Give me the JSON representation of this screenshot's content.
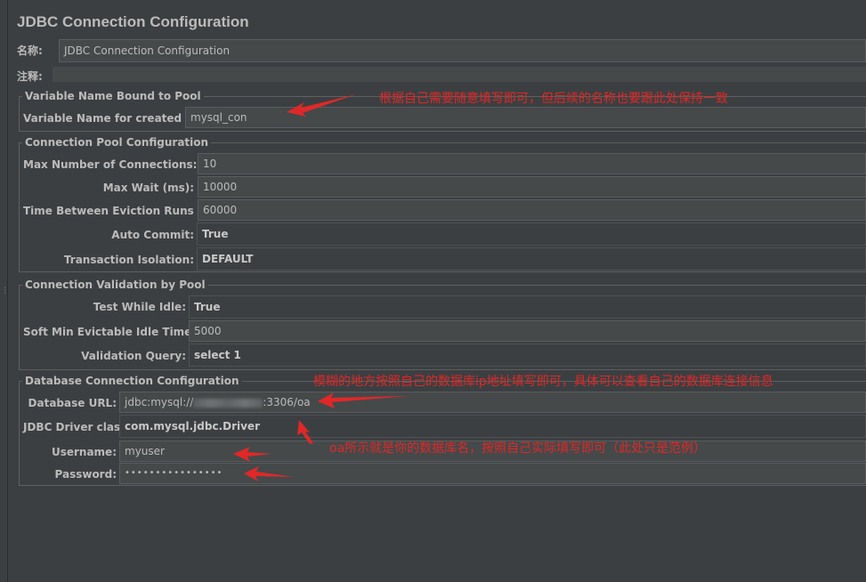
{
  "title": "JDBC Connection Configuration",
  "name_label": "名称:",
  "name_value": "JDBC Connection Configuration",
  "comment_label": "注释:",
  "comment_value": "",
  "pool": {
    "legend": "Variable Name Bound to Pool",
    "var_label": "Variable Name for created pool:",
    "var_value": "mysql_con"
  },
  "conn_pool": {
    "legend": "Connection Pool Configuration",
    "max_conn_label": "Max Number of Connections:",
    "max_conn_value": "10",
    "max_wait_label": "Max Wait (ms):",
    "max_wait_value": "10000",
    "eviction_label": "Time Between Eviction Runs (ms):",
    "eviction_value": "60000",
    "auto_commit_label": "Auto Commit:",
    "auto_commit_value": "True",
    "isolation_label": "Transaction Isolation:",
    "isolation_value": "DEFAULT"
  },
  "validation": {
    "legend": "Connection Validation by Pool",
    "test_idle_label": "Test While Idle:",
    "test_idle_value": "True",
    "soft_min_label": "Soft Min Evictable Idle Time(ms):",
    "soft_min_value": "5000",
    "query_label": "Validation Query:",
    "query_value": "select 1"
  },
  "db": {
    "legend": "Database Connection Configuration",
    "url_label": "Database URL:",
    "url_prefix": "jdbc:mysql://",
    "url_suffix": ":3306/oa",
    "driver_label": "JDBC Driver class:",
    "driver_value": "com.mysql.jdbc.Driver",
    "user_label": "Username:",
    "user_value": "myuser",
    "pass_label": "Password:",
    "pass_value": "••••••••••••••••"
  },
  "notes": {
    "pool_note": "根据自己需要随意填写即可，但后续的名称也要跟此处保持一致",
    "url_note": "模糊的地方按照自己的数据库ip地址填写即可，具体可以查看自己的数据库连接信息",
    "db_note": "oa所示就是你的数据库名，按照自己实际填写即可（此处只是范例）"
  },
  "colors": {
    "background": "#3c3f41",
    "field": "#45494a",
    "text": "#bbbbbb",
    "annotation": "#e02828"
  }
}
